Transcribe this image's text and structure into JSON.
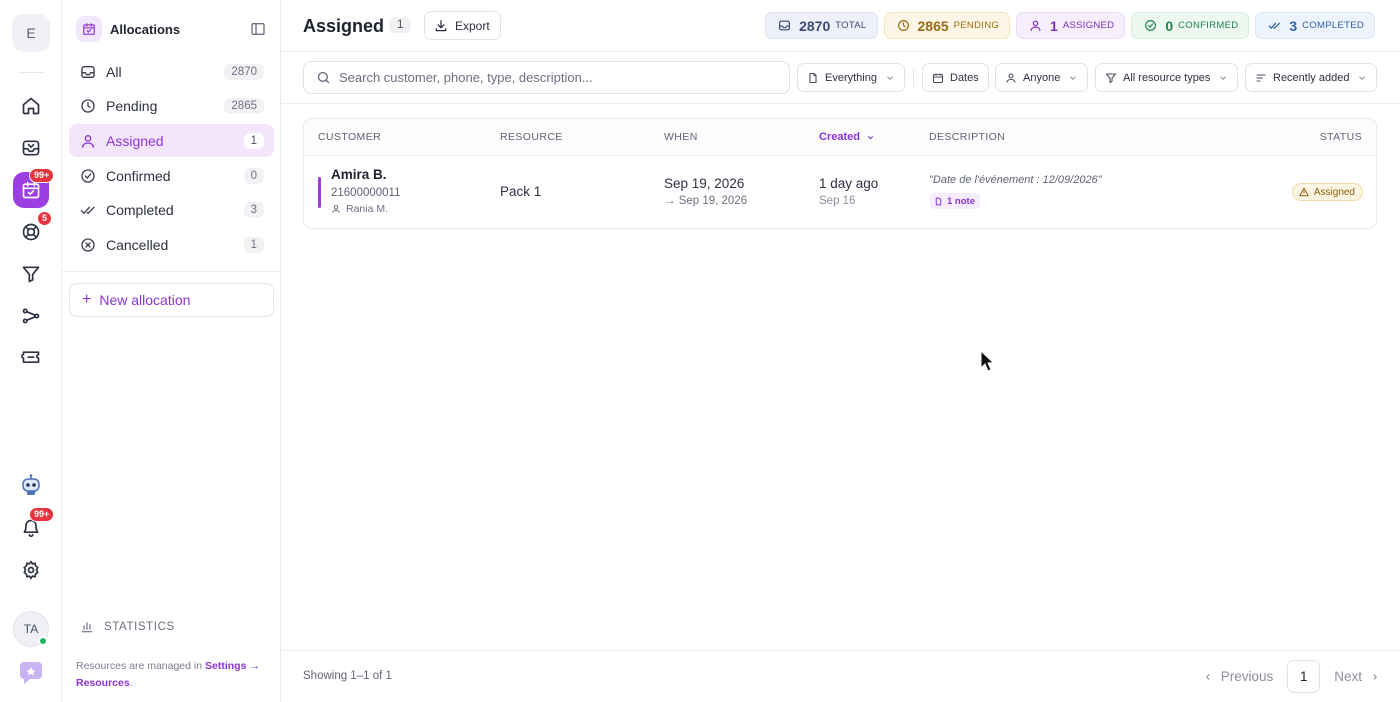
{
  "rail": {
    "workspace_initial": "E",
    "allocations_badge": "99+",
    "support_badge": "5",
    "notifications_badge": "99+",
    "user_initials": "TA"
  },
  "sidebar": {
    "title": "Allocations",
    "items": [
      {
        "label": "All",
        "count": "2870"
      },
      {
        "label": "Pending",
        "count": "2865"
      },
      {
        "label": "Assigned",
        "count": "1"
      },
      {
        "label": "Confirmed",
        "count": "0"
      },
      {
        "label": "Completed",
        "count": "3"
      },
      {
        "label": "Cancelled",
        "count": "1"
      }
    ],
    "new_button": "New allocation",
    "statistics_label": "STATISTICS",
    "note_prefix": "Resources are managed in",
    "note_link": "Settings → Resources",
    "note_suffix": "."
  },
  "header": {
    "title": "Assigned",
    "count": "1",
    "export_label": "Export",
    "chips": [
      {
        "value": "2870",
        "label": "TOTAL"
      },
      {
        "value": "2865",
        "label": "PENDING"
      },
      {
        "value": "1",
        "label": "ASSIGNED"
      },
      {
        "value": "0",
        "label": "CONFIRMED"
      },
      {
        "value": "3",
        "label": "COMPLETED"
      }
    ]
  },
  "filters": {
    "search_placeholder": "Search customer, phone, type, description...",
    "scope": "Everything",
    "dates": "Dates",
    "assignee": "Anyone",
    "resource_type": "All resource types",
    "sort": "Recently added"
  },
  "table": {
    "columns": {
      "customer": "CUSTOMER",
      "resource": "RESOURCE",
      "when": "WHEN",
      "created": "Created",
      "description": "DESCRIPTION",
      "status": "STATUS"
    },
    "rows": [
      {
        "customer_name": "Amira B.",
        "phone": "21600000011",
        "agent": "Rania M.",
        "resource": "Pack 1",
        "when_start": "Sep 19, 2026",
        "when_end": "→ Sep 19, 2026",
        "created_relative": "1 day ago",
        "created_date": "Sep 16",
        "description": "\"Date de l'événement : 12/09/2026\"",
        "notes": "1 note",
        "status": "Assigned"
      }
    ]
  },
  "footer": {
    "showing": "Showing 1–1 of 1",
    "previous": "Previous",
    "page": "1",
    "next": "Next"
  },
  "colors": {
    "accent": "#8b33d6",
    "danger_badge": "#e5343f",
    "online": "#22b35e"
  }
}
